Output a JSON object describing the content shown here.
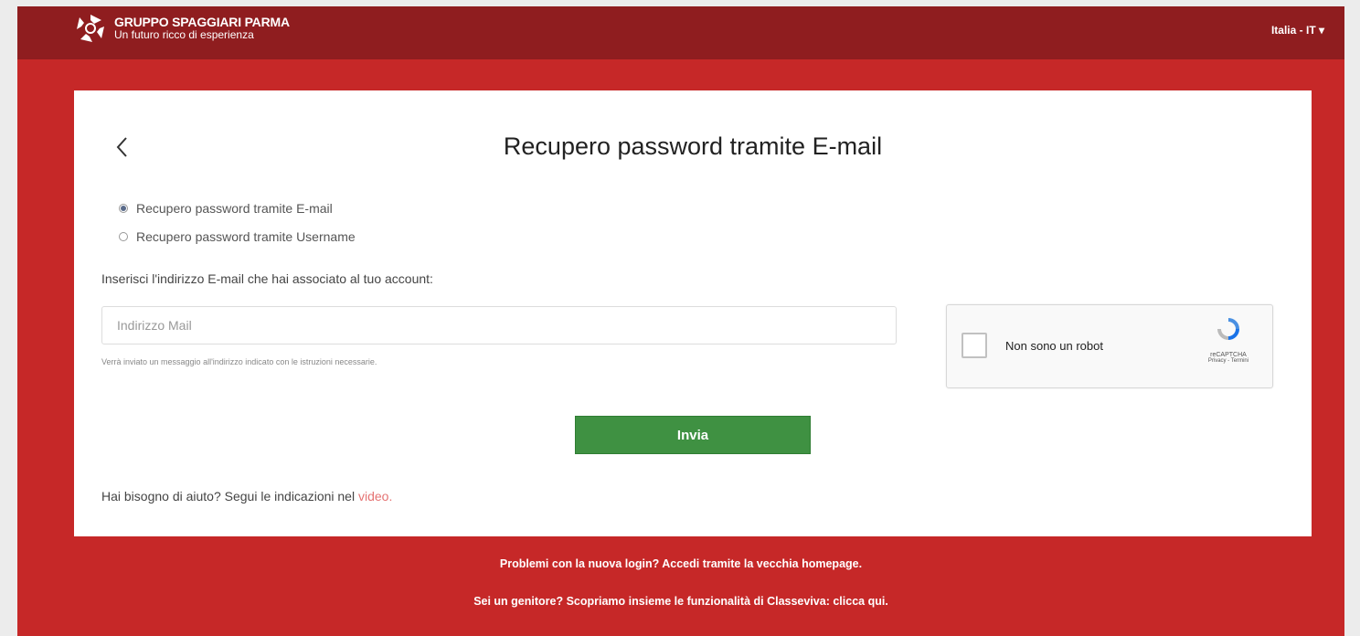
{
  "header": {
    "logo_title": "GRUPPO SPAGGIARI PARMA",
    "logo_subtitle": "Un futuro ricco di esperienza",
    "language_selector": "Italia - IT ▾"
  },
  "form": {
    "title": "Recupero password tramite E-mail",
    "radio_options": [
      {
        "label": "Recupero password tramite E-mail",
        "checked": true
      },
      {
        "label": "Recupero password tramite Username",
        "checked": false
      }
    ],
    "instruction": "Inserisci l'indirizzo E-mail che hai associato al tuo account:",
    "email_placeholder": "Indirizzo Mail",
    "helper_text": "Verrà inviato un messaggio all'indirizzo indicato con le istruzioni necessarie.",
    "submit_label": "Invia",
    "help_prefix": "Hai bisogno di aiuto? Segui le indicazioni nel ",
    "help_link": "video."
  },
  "captcha": {
    "label": "Non sono un robot",
    "brand": "reCAPTCHA",
    "links": "Privacy - Termini"
  },
  "footer": {
    "old_login": "Problemi con la nuova login? Accedi tramite la vecchia homepage.",
    "parent_info": "Sei un genitore? Scopriamo insieme le funzionalità di Classeviva: clicca qui."
  },
  "colors": {
    "page_background": "#c62828",
    "header_background": "#8f1d1f",
    "submit_button": "#3f9142",
    "link": "#e57373"
  }
}
